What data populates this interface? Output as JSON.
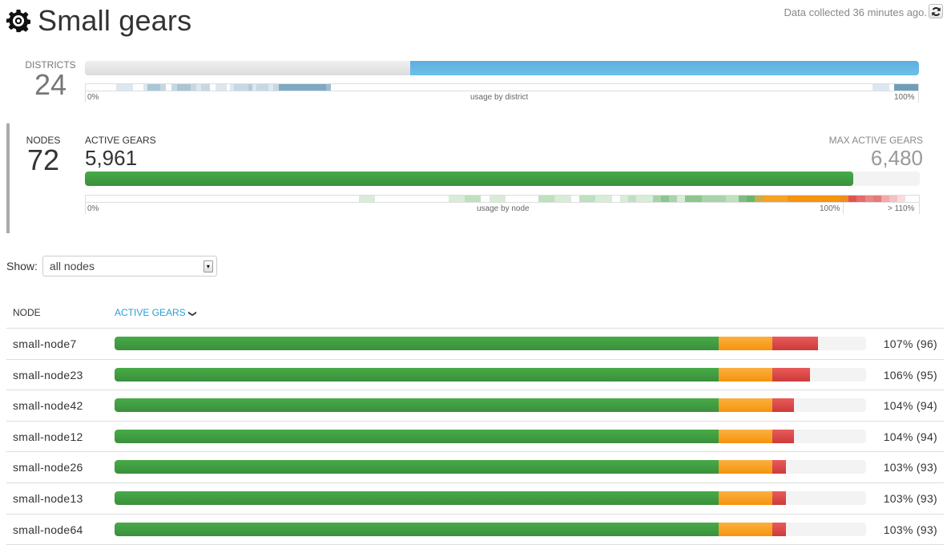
{
  "header": {
    "title": "Small gears",
    "icon": "gear-icon",
    "updated": "Data collected 36 minutes ago.",
    "refresh_icon": "refresh-icon"
  },
  "districts": {
    "label": "DISTRICTS",
    "count": "24",
    "usage_fraction": 0.61,
    "axis_min": "0%",
    "axis_caption": "usage by district",
    "axis_max": "100%",
    "heatmap": [
      {
        "w": 3.5,
        "c": "#ffffff"
      },
      {
        "w": 2.0,
        "c": "#dde7ef"
      },
      {
        "w": 1.2,
        "c": "#ffffff"
      },
      {
        "w": 0.5,
        "c": "#dde7ef"
      },
      {
        "w": 1.5,
        "c": "#aac6d6"
      },
      {
        "w": 0.6,
        "c": "#c5d8e3"
      },
      {
        "w": 0.7,
        "c": "#ffffff"
      },
      {
        "w": 0.6,
        "c": "#c5d8e3"
      },
      {
        "w": 1.6,
        "c": "#a9c5d5"
      },
      {
        "w": 0.7,
        "c": "#c5d8e3"
      },
      {
        "w": 0.5,
        "c": "#dde7ef"
      },
      {
        "w": 1.1,
        "c": "#c5d8e3"
      },
      {
        "w": 0.6,
        "c": "#ffffff"
      },
      {
        "w": 1.3,
        "c": "#dde7ef"
      },
      {
        "w": 0.4,
        "c": "#ffffff"
      },
      {
        "w": 0.5,
        "c": "#dde7ef"
      },
      {
        "w": 1.6,
        "c": "#c5d8e3"
      },
      {
        "w": 0.5,
        "c": "#b1cbda"
      },
      {
        "w": 0.5,
        "c": "#dde7ef"
      },
      {
        "w": 1.4,
        "c": "#c5d8e3"
      },
      {
        "w": 0.5,
        "c": "#dde7ef"
      },
      {
        "w": 0.7,
        "c": "#c5d8e3"
      },
      {
        "w": 5.5,
        "c": "#7ea9c2"
      },
      {
        "w": 0.6,
        "c": "#9dbccf"
      },
      {
        "w": 63.0,
        "c": "#ffffff"
      },
      {
        "w": 2.0,
        "c": "#dde7ef"
      },
      {
        "w": 0.5,
        "c": "#ffffff"
      },
      {
        "w": 2.8,
        "c": "#6f9eb9"
      }
    ]
  },
  "nodes": {
    "label": "NODES",
    "count": "72",
    "active_label": "ACTIVE GEARS",
    "active_value": "5,961",
    "max_label": "MAX ACTIVE GEARS",
    "max_value": "6,480",
    "active_fraction": 0.92,
    "axis_min": "0%",
    "axis_caption": "usage by node",
    "axis_100": "100%",
    "axis_max": "> 110%",
    "heatmap": [
      {
        "w": 33.4,
        "c": "#ffffff"
      },
      {
        "w": 2.0,
        "c": "#d8ecd8"
      },
      {
        "w": 9.0,
        "c": "#ffffff"
      },
      {
        "w": 2.0,
        "c": "#d8ecd8"
      },
      {
        "w": 2.0,
        "c": "#bfe0bf"
      },
      {
        "w": 1.0,
        "c": "#ffffff"
      },
      {
        "w": 2.0,
        "c": "#d8ecd8"
      },
      {
        "w": 4.0,
        "c": "#ffffff"
      },
      {
        "w": 2.0,
        "c": "#bfe0bf"
      },
      {
        "w": 2.0,
        "c": "#d8ecd8"
      },
      {
        "w": 1.0,
        "c": "#ffffff"
      },
      {
        "w": 2.0,
        "c": "#bfe0bf"
      },
      {
        "w": 2.0,
        "c": "#d8ecd8"
      },
      {
        "w": 1.0,
        "c": "#ffffff"
      },
      {
        "w": 1.0,
        "c": "#d8ecd8"
      },
      {
        "w": 1.0,
        "c": "#bfe0bf"
      },
      {
        "w": 2.0,
        "c": "#d8ecd8"
      },
      {
        "w": 1.0,
        "c": "#a9d4a9"
      },
      {
        "w": 1.0,
        "c": "#8cc68c"
      },
      {
        "w": 1.0,
        "c": "#a9d4a9"
      },
      {
        "w": 1.0,
        "c": "#d8ecd8"
      },
      {
        "w": 2.0,
        "c": "#8cc68c"
      },
      {
        "w": 1.0,
        "c": "#a9d4a9"
      },
      {
        "w": 2.0,
        "c": "#a9d4a9"
      },
      {
        "w": 1.5,
        "c": "#bfe0bf"
      },
      {
        "w": 1.0,
        "c": "#7fbd7f"
      },
      {
        "w": 1.0,
        "c": "#6cb36c"
      },
      {
        "w": 1.0,
        "c": "#c8ad4a"
      },
      {
        "w": 3.0,
        "c": "#f7a125"
      },
      {
        "w": 6.5,
        "c": "#f5940d"
      },
      {
        "w": 1.0,
        "c": "#ee8a1f"
      },
      {
        "w": 1.0,
        "c": "#e05252"
      },
      {
        "w": 1.0,
        "c": "#e56b6b"
      },
      {
        "w": 1.0,
        "c": "#eb8585"
      },
      {
        "w": 1.0,
        "c": "#e77878"
      },
      {
        "w": 1.0,
        "c": "#f0aaaa"
      },
      {
        "w": 1.0,
        "c": "#f3c2c2"
      },
      {
        "w": 1.0,
        "c": "#f8dcdc"
      },
      {
        "w": 1.6,
        "c": "#ffffff"
      }
    ]
  },
  "filter": {
    "label": "Show:",
    "selected": "all nodes"
  },
  "table": {
    "col_node": "NODE",
    "col_gears": "ACTIVE GEARS",
    "sort_icon": "chevron-down-icon",
    "colors": {
      "ok": "#43a343",
      "warn": "#f7a125",
      "over": "#d94848",
      "track": "#f3f3f3"
    },
    "rows": [
      {
        "name": "small-node7",
        "percent": 107,
        "gears": 96,
        "label": "107% (96)"
      },
      {
        "name": "small-node23",
        "percent": 106,
        "gears": 95,
        "label": "106% (95)"
      },
      {
        "name": "small-node42",
        "percent": 104,
        "gears": 94,
        "label": "104% (94)"
      },
      {
        "name": "small-node12",
        "percent": 104,
        "gears": 94,
        "label": "104% (94)"
      },
      {
        "name": "small-node26",
        "percent": 103,
        "gears": 93,
        "label": "103% (93)"
      },
      {
        "name": "small-node13",
        "percent": 103,
        "gears": 93,
        "label": "103% (93)"
      },
      {
        "name": "small-node64",
        "percent": 103,
        "gears": 93,
        "label": "103% (93)"
      }
    ]
  }
}
